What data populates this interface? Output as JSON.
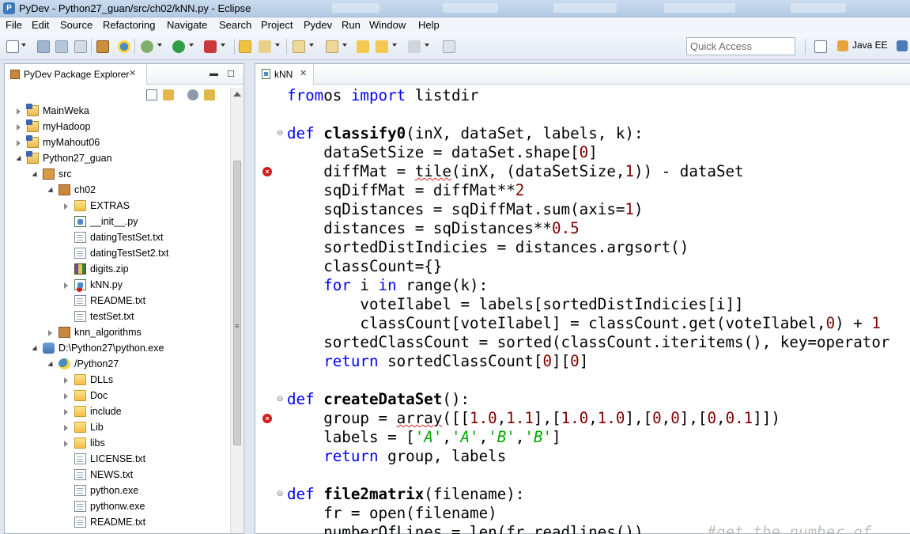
{
  "window": {
    "title": "PyDev - Python27_guan/src/ch02/kNN.py - Eclipse"
  },
  "menu": [
    "File",
    "Edit",
    "Source",
    "Refactoring",
    "Navigate",
    "Search",
    "Project",
    "Pydev",
    "Run",
    "Window",
    "Help"
  ],
  "toolbar": {
    "quick_access_placeholder": "Quick Access",
    "perspective_label": "Java EE"
  },
  "explorer": {
    "title": "PyDev Package Explorer",
    "items": [
      {
        "label": "MainWeka",
        "icon": "project-icon",
        "state": "collapsed",
        "depth": 0
      },
      {
        "label": "myHadoop",
        "icon": "project-icon",
        "state": "collapsed",
        "depth": 0
      },
      {
        "label": "myMahout06",
        "icon": "project-icon",
        "state": "collapsed",
        "depth": 0
      },
      {
        "label": "Python27_guan",
        "icon": "pydev-project-icon",
        "state": "expanded",
        "depth": 0
      },
      {
        "label": "src",
        "icon": "source-folder-icon",
        "state": "expanded",
        "depth": 1
      },
      {
        "label": "ch02",
        "icon": "package-icon",
        "state": "expanded",
        "depth": 2
      },
      {
        "label": "EXTRAS",
        "icon": "folder-icon",
        "state": "collapsed",
        "depth": 3
      },
      {
        "label": "__init__.py",
        "icon": "python-file-icon",
        "state": "none",
        "depth": 3
      },
      {
        "label": "datingTestSet.txt",
        "icon": "text-file-icon",
        "state": "none",
        "depth": 3
      },
      {
        "label": "datingTestSet2.txt",
        "icon": "text-file-icon",
        "state": "none",
        "depth": 3
      },
      {
        "label": "digits.zip",
        "icon": "zip-file-icon",
        "state": "none",
        "depth": 3
      },
      {
        "label": "kNN.py",
        "icon": "python-file-error-icon",
        "state": "collapsed",
        "depth": 3
      },
      {
        "label": "README.txt",
        "icon": "text-file-icon",
        "state": "none",
        "depth": 3
      },
      {
        "label": "testSet.txt",
        "icon": "text-file-icon",
        "state": "none",
        "depth": 3
      },
      {
        "label": "knn_algorithms",
        "icon": "package-icon",
        "state": "collapsed",
        "depth": 2
      },
      {
        "label": "D:\\Python27\\python.exe",
        "icon": "interpreter-icon",
        "state": "expanded",
        "depth": 1
      },
      {
        "label": "/Python27",
        "icon": "python-icon",
        "state": "expanded",
        "depth": 2
      },
      {
        "label": "DLLs",
        "icon": "folder-icon",
        "state": "collapsed",
        "depth": 3
      },
      {
        "label": "Doc",
        "icon": "folder-icon",
        "state": "collapsed",
        "depth": 3
      },
      {
        "label": "include",
        "icon": "folder-icon",
        "state": "collapsed",
        "depth": 3
      },
      {
        "label": "Lib",
        "icon": "folder-icon",
        "state": "collapsed",
        "depth": 3
      },
      {
        "label": "libs",
        "icon": "folder-icon",
        "state": "collapsed",
        "depth": 3
      },
      {
        "label": "LICENSE.txt",
        "icon": "text-file-icon",
        "state": "none",
        "depth": 3
      },
      {
        "label": "NEWS.txt",
        "icon": "text-file-icon",
        "state": "none",
        "depth": 3
      },
      {
        "label": "python.exe",
        "icon": "text-file-icon",
        "state": "none",
        "depth": 3
      },
      {
        "label": "pythonw.exe",
        "icon": "text-file-icon",
        "state": "none",
        "depth": 3
      },
      {
        "label": "README.txt",
        "icon": "text-file-icon",
        "state": "none",
        "depth": 3
      }
    ]
  },
  "editor": {
    "tab_label": "kNN",
    "lines": [
      {
        "n": 0,
        "parts": [
          [
            "kw",
            "from"
          ],
          [
            "",
            "os "
          ],
          [
            "kw",
            "import"
          ],
          [
            "",
            " listdir"
          ]
        ]
      },
      {
        "n": 2,
        "fold": true,
        "parts": [
          [
            "kw",
            "def "
          ],
          [
            "fn",
            "classify0"
          ],
          [
            "",
            "(inX, dataSet, labels, k):"
          ]
        ]
      },
      {
        "n": 3,
        "parts": [
          [
            "",
            "    dataSetSize = dataSet.shape["
          ],
          [
            "num",
            "0"
          ],
          [
            "",
            "]"
          ]
        ]
      },
      {
        "n": 4,
        "error": true,
        "parts": [
          [
            "",
            "    diffMat = "
          ],
          [
            "squig",
            "tile"
          ],
          [
            "",
            "(inX, (dataSetSize,"
          ],
          [
            "num",
            "1"
          ],
          [
            "",
            ")) - dataSet"
          ]
        ]
      },
      {
        "n": 5,
        "parts": [
          [
            "",
            "    sqDiffMat = diffMat**"
          ],
          [
            "num",
            "2"
          ]
        ]
      },
      {
        "n": 6,
        "parts": [
          [
            "",
            "    sqDistances = sqDiffMat.sum(axis="
          ],
          [
            "num",
            "1"
          ],
          [
            "",
            ")"
          ]
        ]
      },
      {
        "n": 7,
        "parts": [
          [
            "",
            "    distances = sqDistances**"
          ],
          [
            "num",
            "0.5"
          ]
        ]
      },
      {
        "n": 8,
        "parts": [
          [
            "",
            "    sortedDistIndicies = distances.argsort()"
          ]
        ]
      },
      {
        "n": 9,
        "parts": [
          [
            "",
            "    classCount={}"
          ]
        ]
      },
      {
        "n": 10,
        "parts": [
          [
            "kw",
            "    for"
          ],
          [
            "",
            " i "
          ],
          [
            "kw",
            "in"
          ],
          [
            "",
            " range(k):"
          ]
        ]
      },
      {
        "n": 11,
        "parts": [
          [
            "",
            "        voteIlabel = labels[sortedDistIndicies[i]]"
          ]
        ]
      },
      {
        "n": 12,
        "parts": [
          [
            "",
            "        classCount[voteIlabel] = classCount.get(voteIlabel,"
          ],
          [
            "num",
            "0"
          ],
          [
            "",
            ") + "
          ],
          [
            "num",
            "1"
          ]
        ]
      },
      {
        "n": 13,
        "parts": [
          [
            "",
            "    sortedClassCount = sorted(classCount.iteritems(), key=operator"
          ]
        ]
      },
      {
        "n": 14,
        "parts": [
          [
            "kw",
            "    return"
          ],
          [
            "",
            " sortedClassCount["
          ],
          [
            "num",
            "0"
          ],
          [
            "",
            "]["
          ],
          [
            "num",
            "0"
          ],
          [
            "",
            "]"
          ]
        ]
      },
      {
        "n": 16,
        "fold": true,
        "parts": [
          [
            "kw",
            "def "
          ],
          [
            "fn",
            "createDataSet"
          ],
          [
            "",
            "():"
          ]
        ]
      },
      {
        "n": 17,
        "error": true,
        "parts": [
          [
            "",
            "    group = "
          ],
          [
            "squig",
            "array"
          ],
          [
            "",
            "([["
          ],
          [
            "num",
            "1.0"
          ],
          [
            "",
            ","
          ],
          [
            "num",
            "1.1"
          ],
          [
            "",
            "],["
          ],
          [
            "num",
            "1.0"
          ],
          [
            "",
            ","
          ],
          [
            "num",
            "1.0"
          ],
          [
            "",
            "],["
          ],
          [
            "num",
            "0"
          ],
          [
            "",
            ","
          ],
          [
            "num",
            "0"
          ],
          [
            "",
            "],["
          ],
          [
            "num",
            "0"
          ],
          [
            "",
            ","
          ],
          [
            "num",
            "0.1"
          ],
          [
            "",
            "]])"
          ]
        ]
      },
      {
        "n": 18,
        "parts": [
          [
            "",
            "    labels = ["
          ],
          [
            "str",
            "'A'"
          ],
          [
            "",
            ","
          ],
          [
            "str",
            "'A'"
          ],
          [
            "",
            ","
          ],
          [
            "str",
            "'B'"
          ],
          [
            "",
            ","
          ],
          [
            "str",
            "'B'"
          ],
          [
            "",
            "]"
          ]
        ]
      },
      {
        "n": 19,
        "parts": [
          [
            "kw",
            "    return"
          ],
          [
            "",
            " group, labels"
          ]
        ]
      },
      {
        "n": 21,
        "fold": true,
        "parts": [
          [
            "kw",
            "def "
          ],
          [
            "fn",
            "file2matrix"
          ],
          [
            "",
            "(filename):"
          ]
        ]
      },
      {
        "n": 22,
        "parts": [
          [
            "",
            "    fr = open(filename)"
          ]
        ]
      },
      {
        "n": 23,
        "parts": [
          [
            "",
            "    numberOfLines = len(fr.readlines())       "
          ],
          [
            "cmt",
            "#get the number of"
          ]
        ]
      }
    ]
  }
}
